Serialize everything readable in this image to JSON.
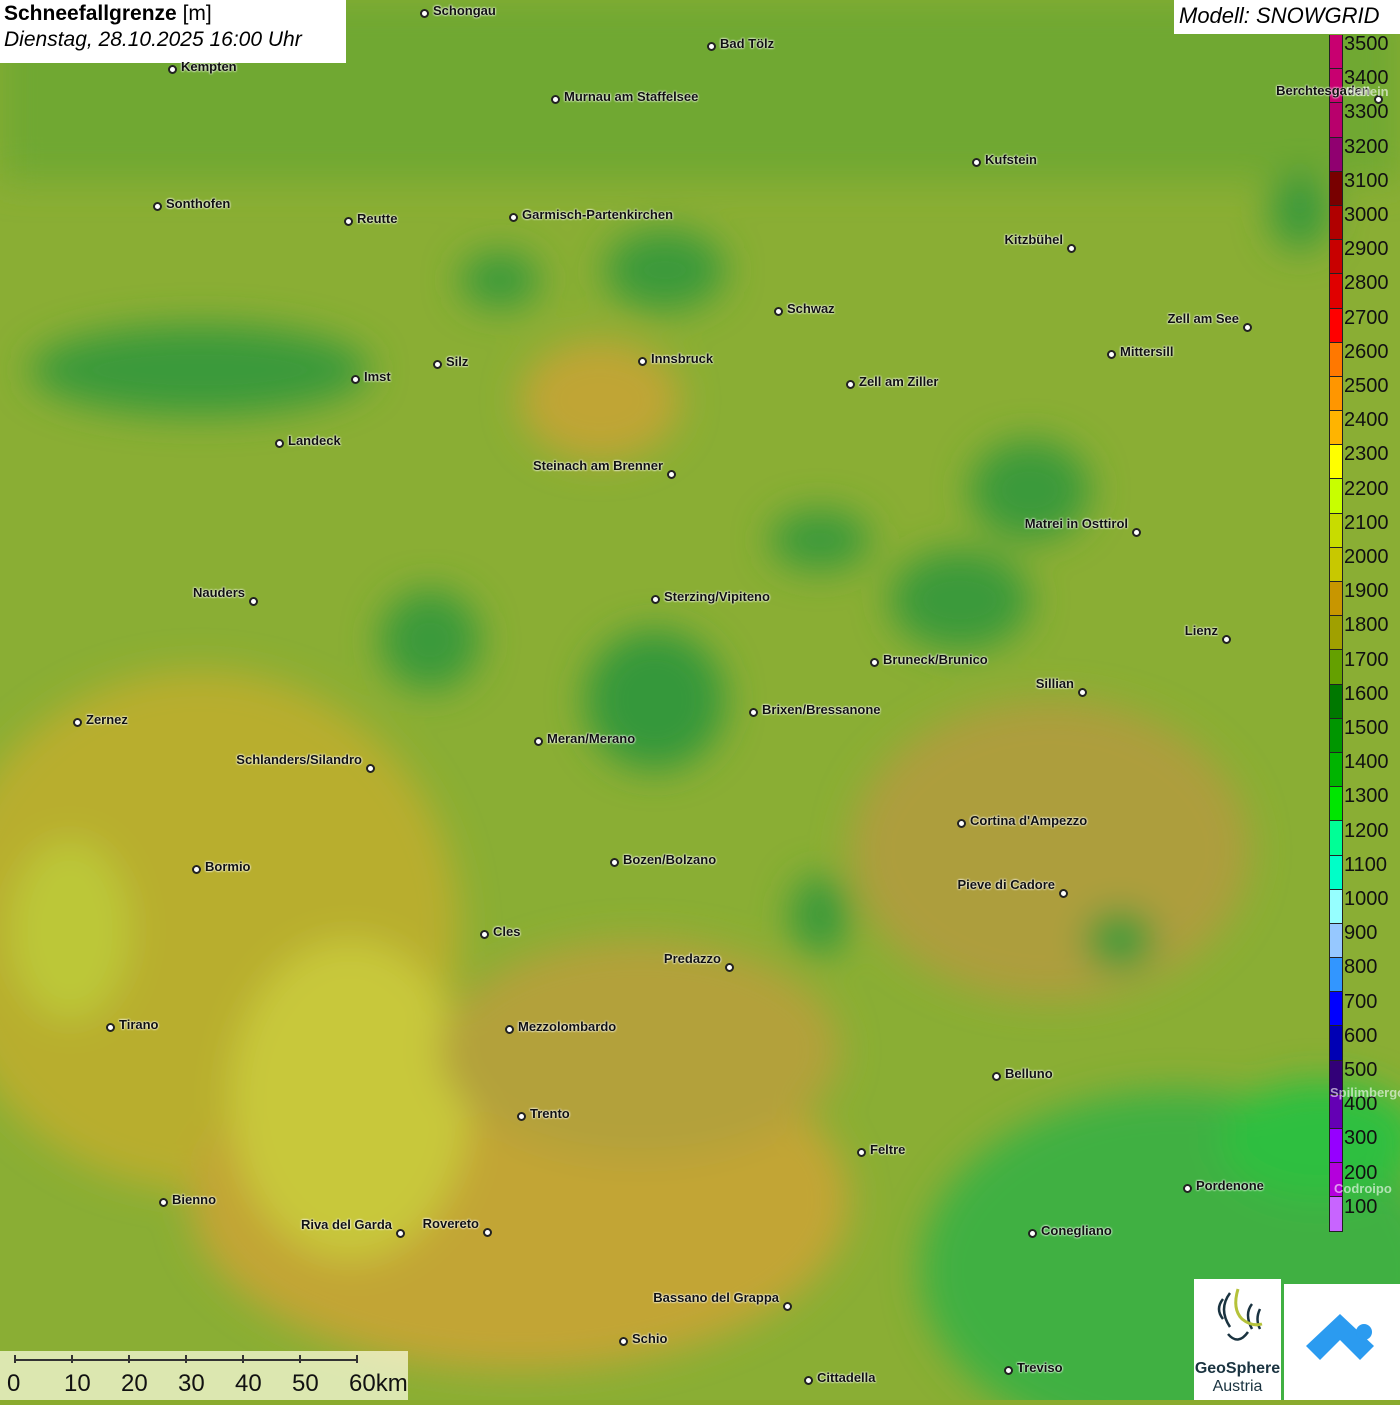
{
  "title": {
    "label": "Schneefallgrenze",
    "unit": "[m]",
    "datetime": "Dienstag, 28.10.2025 16:00 Uhr"
  },
  "model": "Modell: SNOWGRID",
  "legend": [
    {
      "v": "3500",
      "c": "#c80070"
    },
    {
      "v": "3400",
      "c": "#c80070"
    },
    {
      "v": "3300",
      "c": "#b8006c"
    },
    {
      "v": "3200",
      "c": "#900070"
    },
    {
      "v": "3100",
      "c": "#780000"
    },
    {
      "v": "3000",
      "c": "#b00000"
    },
    {
      "v": "2900",
      "c": "#c80000"
    },
    {
      "v": "2800",
      "c": "#e00000"
    },
    {
      "v": "2700",
      "c": "#ff0000"
    },
    {
      "v": "2600",
      "c": "#ff7800"
    },
    {
      "v": "2500",
      "c": "#ff9600"
    },
    {
      "v": "2400",
      "c": "#ffb400"
    },
    {
      "v": "2300",
      "c": "#ffff00"
    },
    {
      "v": "2200",
      "c": "#c8ff00"
    },
    {
      "v": "2100",
      "c": "#c8dc00"
    },
    {
      "v": "2000",
      "c": "#c8c800"
    },
    {
      "v": "1900",
      "c": "#c89600"
    },
    {
      "v": "1800",
      "c": "#a0a000"
    },
    {
      "v": "1700",
      "c": "#64a000"
    },
    {
      "v": "1600",
      "c": "#007800"
    },
    {
      "v": "1500",
      "c": "#009600"
    },
    {
      "v": "1400",
      "c": "#00b400"
    },
    {
      "v": "1300",
      "c": "#00e600"
    },
    {
      "v": "1200",
      "c": "#00ff96"
    },
    {
      "v": "1100",
      "c": "#00ffc8"
    },
    {
      "v": "1000",
      "c": "#96ffff"
    },
    {
      "v": "900",
      "c": "#96c8ff"
    },
    {
      "v": "800",
      "c": "#3296ff"
    },
    {
      "v": "700",
      "c": "#0000ff"
    },
    {
      "v": "600",
      "c": "#0000b4"
    },
    {
      "v": "500",
      "c": "#320078"
    },
    {
      "v": "400",
      "c": "#6400b4"
    },
    {
      "v": "300",
      "c": "#9600ff"
    },
    {
      "v": "200",
      "c": "#b400dc"
    },
    {
      "v": "100",
      "c": "#c864ff"
    }
  ],
  "cities": [
    "Schongau",
    "Bad Tölz",
    "Kempten",
    "Murnau am Staffelsee",
    "Berchtesgaden",
    "Kufstein",
    "Sonthofen",
    "Reutte",
    "Garmisch-Partenkirchen",
    "Kitzbühel",
    "Schwaz",
    "Zell am See",
    "Innsbruck",
    "Mittersill",
    "Silz",
    "Imst",
    "Zell am Ziller",
    "Landeck",
    "Steinach am Brenner",
    "Matrei in Osttirol",
    "Nauders",
    "Sterzing/Vipiteno",
    "Lienz",
    "Bruneck/Brunico",
    "Sillian",
    "Brixen/Bressanone",
    "Zernez",
    "Meran/Merano",
    "Schlanders/Silandro",
    "Cortina d'Ampezzo",
    "Bozen/Bolzano",
    "Bormio",
    "Pieve di Cadore",
    "Cles",
    "Predazzo",
    "Tirano",
    "Mezzolombardo",
    "Belluno",
    "Trento",
    "Feltre",
    "Pordenone",
    "Bienno",
    "Riva del Garda",
    "Rovereto",
    "Conegliano",
    "Bassano del Grappa",
    "Schio",
    "Treviso",
    "Cittadella"
  ],
  "faint_cities": [
    "Hallein",
    "Spilimbergo",
    "Codroipo"
  ],
  "scale": [
    "0",
    "10",
    "20",
    "30",
    "40",
    "50",
    "60km"
  ],
  "logos": {
    "geosphere_1": "GeoSphere",
    "geosphere_2": "Austria"
  }
}
